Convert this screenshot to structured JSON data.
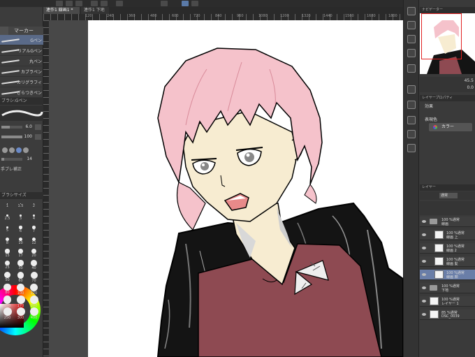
{
  "doc_tabs": [
    "連作1 線画1 *",
    "連作1 下地1"
  ],
  "ruler_ticks": [
    "120",
    "240",
    "360",
    "480",
    "600",
    "720",
    "840",
    "960",
    "1080",
    "1200",
    "1320",
    "1440",
    "1560",
    "1680",
    "1800"
  ],
  "subtool": {
    "active_tab": "マーカー",
    "brushes": [
      "Gペン",
      "リアルGペン",
      "丸ペン",
      "カブラペン",
      "カリグラフィ",
      "ざらつきペン"
    ]
  },
  "tool_property": {
    "header": "ブラシ:Gペン",
    "brush_size": "6.0",
    "opacity": "100",
    "hardness": "14",
    "stabilization_label": "手ブレ補正"
  },
  "brush_size_panel": {
    "header": "ブラシサイズ",
    "sizes": [
      "1",
      "1.5",
      "2",
      "2.5",
      "3",
      "4",
      "5",
      "6",
      "7",
      "8",
      "10",
      "12",
      "15",
      "17",
      "20",
      "25",
      "30",
      "40",
      "50",
      "60",
      "70",
      "80",
      "100",
      "120",
      "150",
      "170",
      "200",
      "250",
      "300",
      "400"
    ]
  },
  "navigator": {
    "header": "ナビゲーター",
    "zoom": "45.5",
    "angle": "0.0"
  },
  "layer_property": {
    "header": "レイヤープロパティ",
    "effect_label": "効果",
    "expression_label": "表現色",
    "color_button": "カラー"
  },
  "layer_panel": {
    "header": "レイヤー",
    "blend_mode": "通常",
    "layers": [
      {
        "top": "100 %通常",
        "bottom": "線画",
        "kind": "folder"
      },
      {
        "top": "100 %通常",
        "bottom": "線画 上",
        "kind": "layer"
      },
      {
        "top": "100 %通常",
        "bottom": "線画 2",
        "kind": "layer"
      },
      {
        "top": "100 %通常",
        "bottom": "線画 髪",
        "kind": "layer"
      },
      {
        "top": "100 %通常",
        "bottom": "線画 顔",
        "kind": "layer",
        "selected": true
      },
      {
        "top": "100 %通常",
        "bottom": "下地",
        "kind": "folder"
      },
      {
        "top": "100 %通常",
        "bottom": "レイヤー 1",
        "kind": "layer"
      },
      {
        "top": "85 %通常",
        "bottom": "DSC_0039",
        "kind": "layer"
      }
    ]
  },
  "colors": {
    "hair": "#f5c2cb",
    "skin": "#f7ecd1",
    "shirt": "#8e4a52",
    "jacket": "#141414",
    "selection": "#6a7ea8"
  }
}
